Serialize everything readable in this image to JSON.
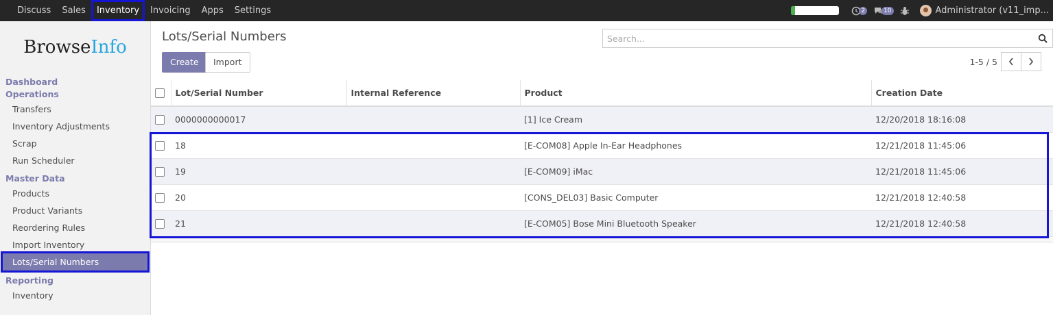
{
  "topbar": {
    "menu": [
      "Discuss",
      "Sales",
      "Inventory",
      "Invoicing",
      "Apps",
      "Settings"
    ],
    "active_menu": "Inventory",
    "progress_fraction": 0.08,
    "progress_color": "#4caf50",
    "activity_count": "2",
    "message_count": "10",
    "user_name": "Administrator (v11_imp..."
  },
  "sidebar": {
    "logo_browse": "Browse",
    "logo_info": "Info",
    "logo_info_color": "#27a6e0",
    "sections": [
      {
        "title": "Dashboard",
        "items": []
      },
      {
        "title": "Operations",
        "items": [
          "Transfers",
          "Inventory Adjustments",
          "Scrap",
          "Run Scheduler"
        ]
      },
      {
        "title": "Master Data",
        "items": [
          "Products",
          "Product Variants",
          "Reordering Rules",
          "Import Inventory",
          "Lots/Serial Numbers"
        ]
      },
      {
        "title": "Reporting",
        "items": [
          "Inventory"
        ]
      }
    ],
    "active_item": "Lots/Serial Numbers"
  },
  "control_panel": {
    "title": "Lots/Serial Numbers",
    "create_label": "Create",
    "import_label": "Import",
    "search_placeholder": "Search...",
    "pager": "1-5 / 5"
  },
  "table": {
    "columns": [
      "Lot/Serial Number",
      "Internal Reference",
      "Product",
      "Creation Date"
    ],
    "rows": [
      {
        "lot": "0000000000017",
        "ref": "",
        "product": "[1] Ice Cream",
        "date": "12/20/2018 18:16:08"
      },
      {
        "lot": "18",
        "ref": "",
        "product": "[E-COM08] Apple In-Ear Headphones",
        "date": "12/21/2018 11:45:06"
      },
      {
        "lot": "19",
        "ref": "",
        "product": "[E-COM09] iMac",
        "date": "12/21/2018 11:45:06"
      },
      {
        "lot": "20",
        "ref": "",
        "product": "[CONS_DEL03] Basic Computer",
        "date": "12/21/2018 12:40:58"
      },
      {
        "lot": "21",
        "ref": "",
        "product": "[E-COM05] Bose Mini Bluetooth Speaker",
        "date": "12/21/2018 12:40:58"
      }
    ]
  },
  "accent_color": "#7c7bad",
  "highlight_color": "#1515d6"
}
